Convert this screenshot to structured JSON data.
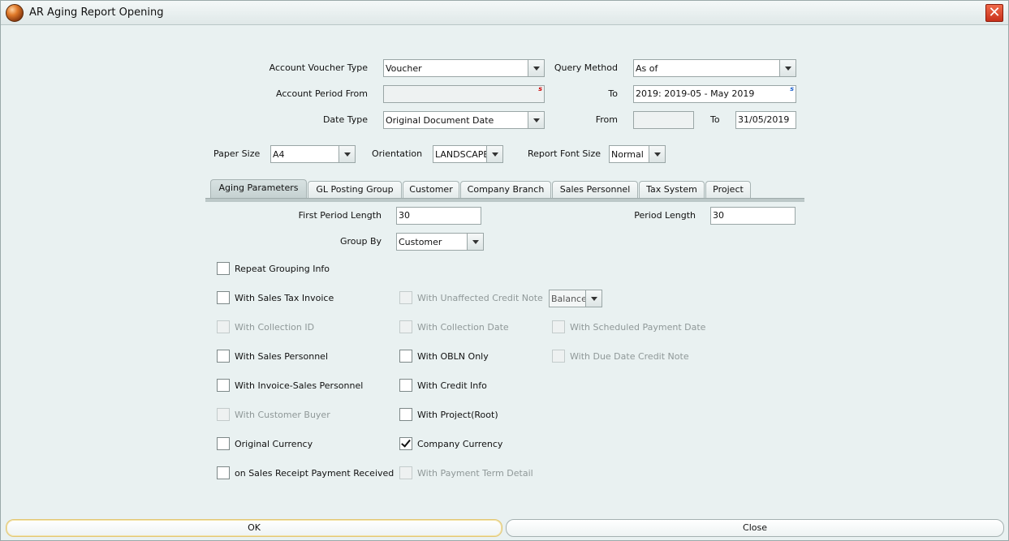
{
  "window": {
    "title": "AR Aging Report Opening",
    "close_glyph": "✕"
  },
  "header": {
    "account_voucher_type": {
      "label": "Account Voucher Type",
      "value": "Voucher"
    },
    "query_method": {
      "label": "Query Method",
      "value": "As of"
    },
    "account_period_from": {
      "label": "Account Period From",
      "value": "",
      "flag": "s",
      "flag_color": "#cc0000"
    },
    "account_period_to": {
      "label": "To",
      "value": "2019: 2019-05 - May 2019",
      "flag": "s",
      "flag_color": "#1a5fcc"
    },
    "date_type": {
      "label": "Date Type",
      "value": "Original Document Date"
    },
    "date_from": {
      "label": "From",
      "value": ""
    },
    "date_to": {
      "label": "To",
      "value": "31/05/2019"
    },
    "paper_size": {
      "label": "Paper Size",
      "value": "A4"
    },
    "orientation": {
      "label": "Orientation",
      "value": "LANDSCAPE"
    },
    "report_font_size": {
      "label": "Report Font Size",
      "value": "Normal"
    }
  },
  "tabs": [
    {
      "label": "Aging Parameters",
      "active": true
    },
    {
      "label": "GL Posting Group",
      "active": false
    },
    {
      "label": "Customer",
      "active": false
    },
    {
      "label": "Company Branch",
      "active": false
    },
    {
      "label": "Sales Personnel",
      "active": false
    },
    {
      "label": "Tax System",
      "active": false
    },
    {
      "label": "Project",
      "active": false
    }
  ],
  "aging": {
    "first_period_length": {
      "label": "First Period Length",
      "value": "30"
    },
    "period_length": {
      "label": "Period Length",
      "value": "30"
    },
    "group_by": {
      "label": "Group By",
      "value": "Customer"
    },
    "balance_select": {
      "value": "Balance"
    }
  },
  "checkboxes": [
    {
      "label": "Repeat Grouping Info",
      "checked": false,
      "disabled": false
    },
    {
      "label": "With Sales Tax Invoice",
      "checked": false,
      "disabled": false
    },
    {
      "label": "With Unaffected Credit Note",
      "checked": false,
      "disabled": true
    },
    {
      "label": "With Collection ID",
      "checked": false,
      "disabled": true
    },
    {
      "label": "With Collection Date",
      "checked": false,
      "disabled": true
    },
    {
      "label": "With Scheduled Payment Date",
      "checked": false,
      "disabled": true
    },
    {
      "label": "With Sales Personnel",
      "checked": false,
      "disabled": false
    },
    {
      "label": "With OBLN Only",
      "checked": false,
      "disabled": false
    },
    {
      "label": "With Due Date Credit Note",
      "checked": false,
      "disabled": true
    },
    {
      "label": "With Invoice-Sales Personnel",
      "checked": false,
      "disabled": false
    },
    {
      "label": "With Credit Info",
      "checked": false,
      "disabled": false
    },
    {
      "label": "With Customer Buyer",
      "checked": false,
      "disabled": true
    },
    {
      "label": "With Project(Root)",
      "checked": false,
      "disabled": false
    },
    {
      "label": "Original Currency",
      "checked": false,
      "disabled": false
    },
    {
      "label": "Company Currency",
      "checked": true,
      "disabled": false
    },
    {
      "label": "on Sales Receipt Payment Received",
      "checked": false,
      "disabled": false
    },
    {
      "label": "With Payment Term Detail",
      "checked": false,
      "disabled": true
    }
  ],
  "footer": {
    "ok_label": "OK",
    "close_label": "Close"
  }
}
